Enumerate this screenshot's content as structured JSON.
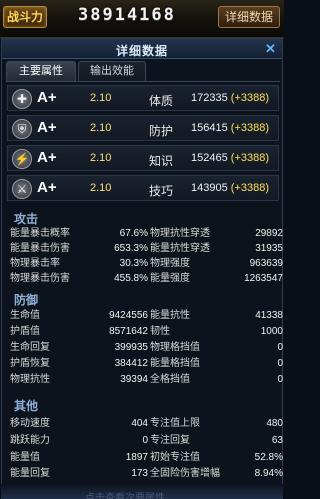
{
  "header": {
    "power_label": "战斗力",
    "power_value": "38914168",
    "detail_button": "详细数据"
  },
  "panel": {
    "title": "详细数据",
    "close": "✕",
    "tabs": [
      {
        "label": "主要属性",
        "active": true
      },
      {
        "label": "输出效能",
        "active": false
      }
    ]
  },
  "core_stats": [
    {
      "icon": "health-cross-icon",
      "glyph": "✚",
      "grade": "A+",
      "ratio": "2.10",
      "name": "体质",
      "value": "172335",
      "bonus": "(+3388)"
    },
    {
      "icon": "shield-icon",
      "glyph": "⛨",
      "grade": "A+",
      "ratio": "2.10",
      "name": "防护",
      "value": "156415",
      "bonus": "(+3388)"
    },
    {
      "icon": "wand-icon",
      "glyph": "⚡",
      "grade": "A+",
      "ratio": "2.10",
      "name": "知识",
      "value": "152465",
      "bonus": "(+3388)"
    },
    {
      "icon": "sword-icon",
      "glyph": "⚔",
      "grade": "A+",
      "ratio": "2.10",
      "name": "技巧",
      "value": "143905",
      "bonus": "(+3388)"
    }
  ],
  "sections": {
    "attack": {
      "title": "攻击",
      "left": [
        {
          "k": "能量暴击概率",
          "v": "67.6%"
        },
        {
          "k": "能量暴击伤害",
          "v": "653.3%"
        },
        {
          "k": "物理暴击率",
          "v": "30.3%"
        },
        {
          "k": "物理暴击伤害",
          "v": "455.8%"
        }
      ],
      "right": [
        {
          "k": "物理抗性穿透",
          "v": "29892"
        },
        {
          "k": "能量抗性穿透",
          "v": "31935"
        },
        {
          "k": "物理强度",
          "v": "963639"
        },
        {
          "k": "能量强度",
          "v": "1263547"
        }
      ]
    },
    "defense": {
      "title": "防御",
      "left": [
        {
          "k": "生命值",
          "v": "9424556"
        },
        {
          "k": "护盾值",
          "v": "8571642"
        },
        {
          "k": "生命回复",
          "v": "399935"
        },
        {
          "k": "护盾恢复",
          "v": "384412"
        },
        {
          "k": "物理抗性",
          "v": "39394"
        }
      ],
      "right": [
        {
          "k": "能量抗性",
          "v": "41338"
        },
        {
          "k": "韧性",
          "v": "1000"
        },
        {
          "k": "物理格挡值",
          "v": "0"
        },
        {
          "k": "能量格挡值",
          "v": "0"
        },
        {
          "k": "全格挡值",
          "v": "0"
        }
      ]
    },
    "other": {
      "title": "其他",
      "left": [
        {
          "k": "移动速度",
          "v": "404"
        },
        {
          "k": "跳跃能力",
          "v": "0"
        },
        {
          "k": "能量值",
          "v": "1897"
        },
        {
          "k": "能量回复",
          "v": "173"
        }
      ],
      "right": [
        {
          "k": "专注值上限",
          "v": "480"
        },
        {
          "k": "专注回复",
          "v": "63"
        },
        {
          "k": "初始专注值",
          "v": "52.8%"
        },
        {
          "k": "全固险伤害增幅",
          "v": "8.94%"
        }
      ]
    }
  },
  "footer_hint": "点击查看次要属性"
}
